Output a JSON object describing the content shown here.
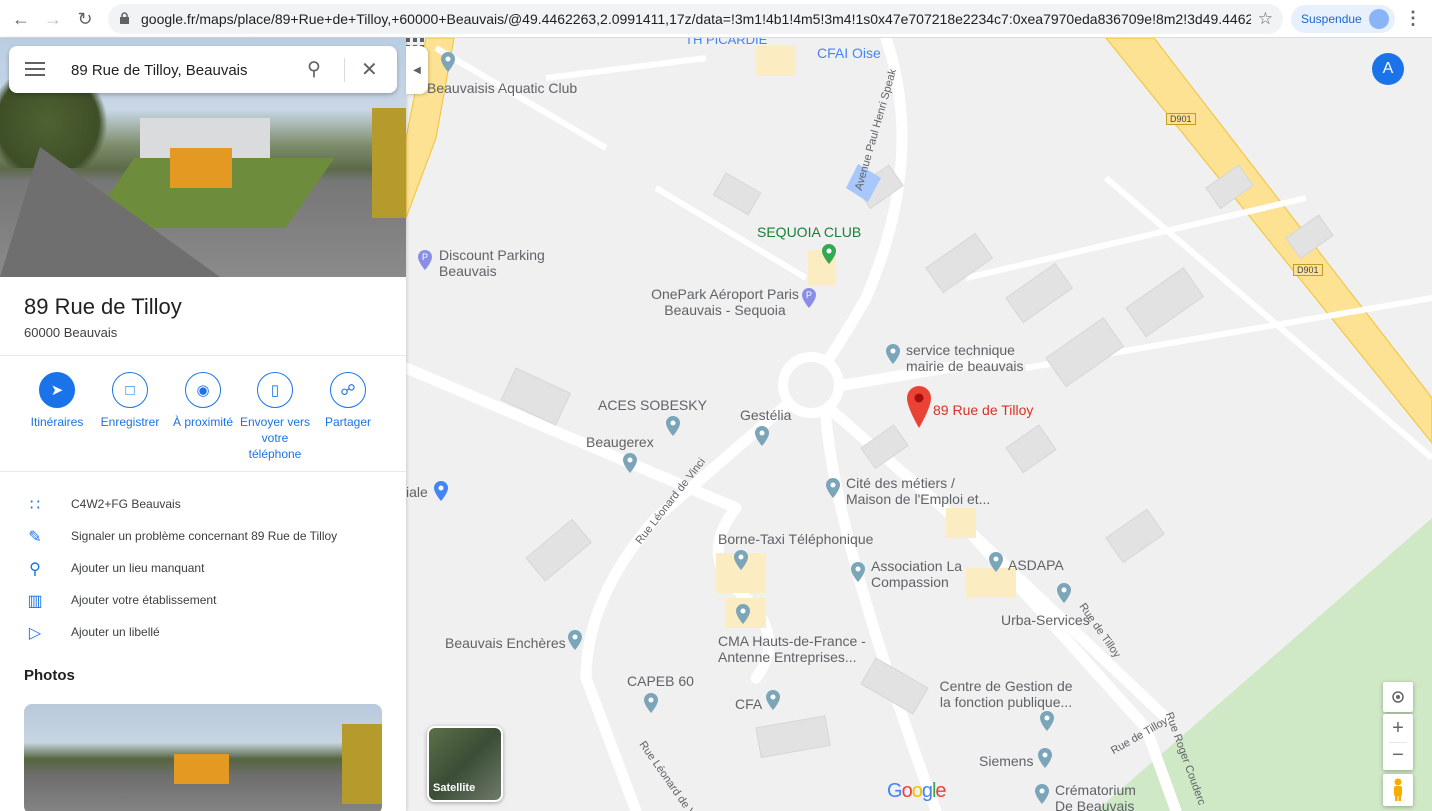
{
  "browser": {
    "url": "google.fr/maps/place/89+Rue+de+Tilloy,+60000+Beauvais/@49.4462263,2.0991411,17z/data=!3m1!4b1!4m5!3m4!1s0x47e707218e2234c7:0xea7970eda836709e!8m2!3d49.4462...",
    "profile_status": "Suspendue"
  },
  "search": {
    "value": "89 Rue de Tilloy, Beauvais"
  },
  "place": {
    "title": "89 Rue de Tilloy",
    "subtitle": "60000 Beauvais"
  },
  "actions": [
    {
      "label": "Itinéraires",
      "icon": "directions-icon"
    },
    {
      "label": "Enregistrer",
      "icon": "bookmark-icon"
    },
    {
      "label": "À proximité",
      "icon": "nearby-icon"
    },
    {
      "label": "Envoyer vers votre téléphone",
      "icon": "send-to-phone-icon"
    },
    {
      "label": "Partager",
      "icon": "share-icon"
    }
  ],
  "info_rows": [
    {
      "text": "C4W2+FG Beauvais",
      "icon": "plus-code-icon"
    },
    {
      "text": "Signaler un problème concernant 89 Rue de Tilloy",
      "icon": "edit-icon"
    },
    {
      "text": "Ajouter un lieu manquant",
      "icon": "add-location-icon"
    },
    {
      "text": "Ajouter votre établissement",
      "icon": "add-business-icon"
    },
    {
      "text": "Ajouter un libellé",
      "icon": "label-icon"
    }
  ],
  "photos_heading": "Photos",
  "map": {
    "places": [
      {
        "name": "TH PICARDIE"
      },
      {
        "name": "CFAI Oise"
      },
      {
        "name": "Beauvaisis Aquatic Club"
      },
      {
        "name": "SEQUOIA CLUB"
      },
      {
        "name": "Discount Parking Beauvais"
      },
      {
        "name": "OnePark Aéroport Paris Beauvais - Sequoia"
      },
      {
        "name": "service technique mairie de beauvais"
      },
      {
        "name": "89 Rue de Tilloy"
      },
      {
        "name": "ACES SOBESKY"
      },
      {
        "name": "Gestélia"
      },
      {
        "name": "Beaugerex"
      },
      {
        "name": "iale"
      },
      {
        "name": "Cité des métiers / Maison de l'Emploi et..."
      },
      {
        "name": "Borne-Taxi Téléphonique"
      },
      {
        "name": "Association La Compassion"
      },
      {
        "name": "ASDAPA"
      },
      {
        "name": "Urba-Services"
      },
      {
        "name": "Beauvais Enchères"
      },
      {
        "name": "CMA Hauts-de-France - Antenne Entreprises..."
      },
      {
        "name": "CAPEB 60"
      },
      {
        "name": "CFA"
      },
      {
        "name": "Centre de Gestion de la fonction publique..."
      },
      {
        "name": "Siemens"
      },
      {
        "name": "Crématorium De Beauvais"
      }
    ],
    "roads": [
      {
        "name": "Avenue Paul Henri Speak"
      },
      {
        "name": "Rue Léonard de Vinci"
      },
      {
        "name": "Rue Léonard de Vinci"
      },
      {
        "name": "Rue de Tilloy"
      },
      {
        "name": "Rue de Tilloy"
      },
      {
        "name": "Rue Roger Couderc"
      }
    ],
    "road_shields": [
      "D901",
      "D901"
    ],
    "satellite_label": "Satellite",
    "account_initial": "A",
    "logo": "Google"
  },
  "colors": {
    "accent": "#1a73e8",
    "red_pin": "#ea4335",
    "green": "#188038",
    "map_bg": "#f0f0f0",
    "highway": "#fde293"
  }
}
